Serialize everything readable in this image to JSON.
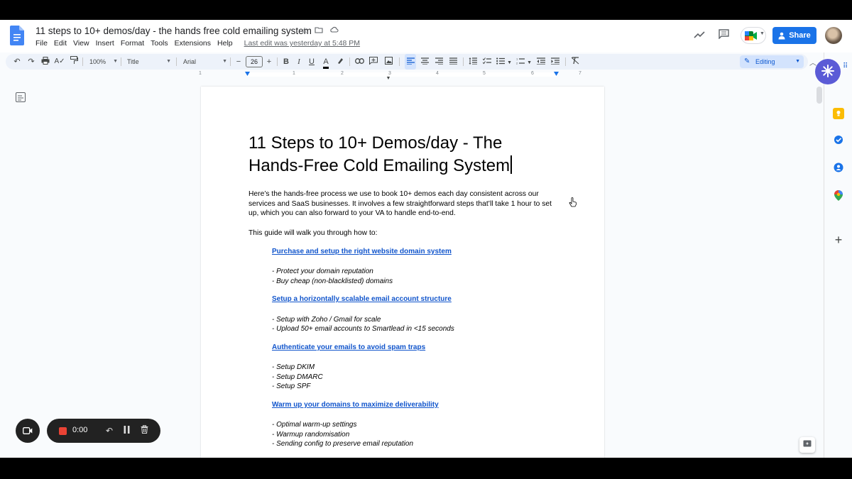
{
  "doc": {
    "title": "11 steps to 10+ demos/day - the hands free cold emailing system",
    "last_edit": "Last edit was yesterday at 5:48 PM"
  },
  "menu": [
    "File",
    "Edit",
    "View",
    "Insert",
    "Format",
    "Tools",
    "Extensions",
    "Help"
  ],
  "header": {
    "share_label": "Share"
  },
  "toolbar": {
    "zoom": "100%",
    "style": "Title",
    "font": "Arial",
    "font_size": "26",
    "mode": "Editing"
  },
  "ruler": [
    "1",
    "1",
    "2",
    "3",
    "4",
    "5",
    "6",
    "7"
  ],
  "content": {
    "heading_line1": "11 Steps to 10+ Demos/day - The",
    "heading_line2": "Hands-Free Cold Emailing System",
    "intro": "Here’s the hands-free process we use to book 10+ demos each day consistent across our services and SaaS businesses. It involves a few straightforward steps that’ll take 1 hour to set up, which you can also forward to your VA to handle end-to-end.",
    "guide": "This guide will walk you through how to:",
    "steps": [
      {
        "title": "Purchase and setup the right website domain system",
        "items": [
          "- Protect your domain reputation",
          "- Buy cheap (non-blacklisted) domains"
        ]
      },
      {
        "title": "Setup a horizontally scalable email account structure",
        "items": [
          "- Setup with Zoho / Gmail for scale",
          "- Upload 50+ email accounts to Smartlead in <15 seconds"
        ]
      },
      {
        "title": "Authenticate your emails to avoid spam traps",
        "items": [
          "- Setup DKIM",
          "- Setup DMARC",
          "- Setup SPF"
        ]
      },
      {
        "title": "Warm up your domains to maximize deliverability",
        "items": [
          "- Optimal warm-up settings",
          "- Warmup randomisation",
          "- Sending config to preserve email reputation"
        ]
      }
    ]
  },
  "recorder": {
    "time": "0:00"
  },
  "colors": {
    "accent": "#1a73e8",
    "link": "#1155cc",
    "record": "#ea4335"
  }
}
